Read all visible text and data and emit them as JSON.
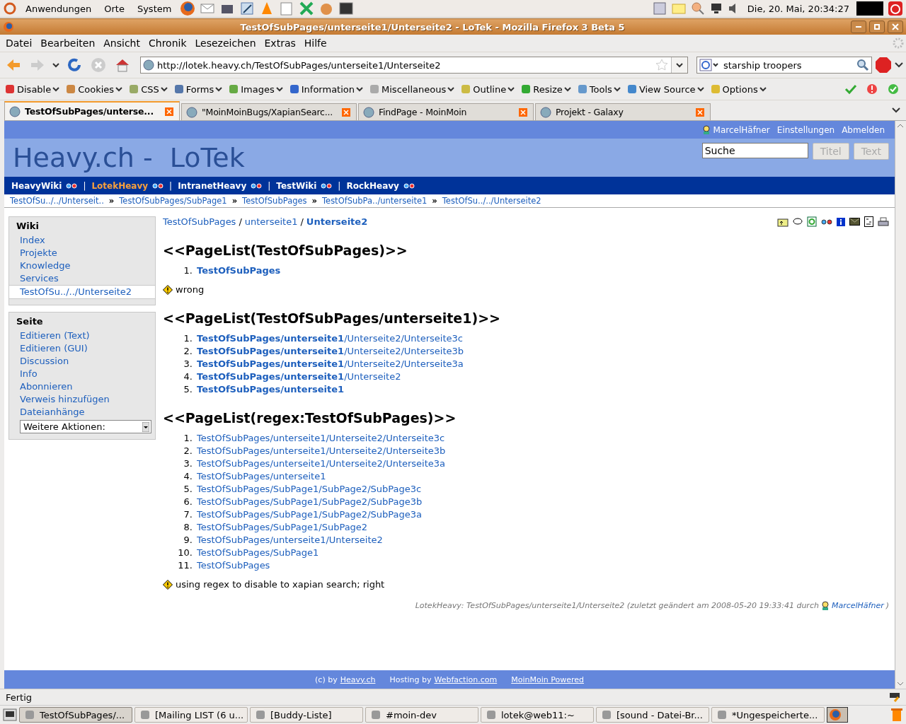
{
  "top_panel": {
    "menus": [
      "Anwendungen",
      "Orte",
      "System"
    ],
    "clock": "Die, 20. Mai, 20:34:27"
  },
  "window": {
    "title": "TestOfSubPages/unterseite1/Unterseite2 - LoTek - Mozilla Firefox 3 Beta 5"
  },
  "menu_bar": [
    "Datei",
    "Bearbeiten",
    "Ansicht",
    "Chronik",
    "Lesezeichen",
    "Extras",
    "Hilfe"
  ],
  "address_bar": {
    "value": "http://lotek.heavy.ch/TestOfSubPages/unterseite1/Unterseite2"
  },
  "search_bar": {
    "value": "starship troopers"
  },
  "dev_toolbar": [
    "Disable",
    "Cookies",
    "CSS",
    "Forms",
    "Images",
    "Information",
    "Miscellaneous",
    "Outline",
    "Resize",
    "Tools",
    "View Source",
    "Options"
  ],
  "tabs": [
    {
      "label": "TestOfSubPages/unterse...",
      "selected": true
    },
    {
      "label": "\"MoinMoinBugs/XapianSearc...",
      "selected": false
    },
    {
      "label": "FindPage - MoinMoin",
      "selected": false
    },
    {
      "label": "Projekt - Galaxy",
      "selected": false
    }
  ],
  "wiki": {
    "user_links": [
      "MarcelHäfner",
      "Einstellungen",
      "Abmelden"
    ],
    "logo": "Heavy.ch -  LoTek",
    "search": {
      "value": "Suche"
    },
    "search_buttons": [
      {
        "label": "Titel",
        "disabled": true
      },
      {
        "label": "Text",
        "disabled": true
      }
    ],
    "interwiki": [
      {
        "label": "HeavyWiki",
        "selected": false
      },
      {
        "sep": "|",
        "label": "LotekHeavy",
        "selected": true
      },
      {
        "sep": "|",
        "label": "IntranetHeavy",
        "selected": false
      },
      {
        "sep": "|",
        "label": "TestWiki",
        "selected": false
      },
      {
        "sep": "|",
        "label": "RockHeavy",
        "selected": false
      }
    ],
    "breadcrumbs": [
      {
        "label": "TestOfSu../../Unterseit.."
      },
      {
        "sep": "»",
        "label": "TestOfSubPages/SubPage1"
      },
      {
        "sep": "»",
        "label": "TestOfSubPages"
      },
      {
        "sep": "»",
        "label": "TestOfSubPa../unterseite1"
      },
      {
        "sep": "»",
        "label": "TestOfSu../../Unterseite2"
      }
    ],
    "sidebar": [
      {
        "title": "Wiki",
        "items": [
          {
            "label": "Index",
            "selected": false
          },
          {
            "label": "Projekte",
            "selected": false
          },
          {
            "label": "Knowledge",
            "selected": false
          },
          {
            "label": "Services",
            "selected": false
          },
          {
            "label": "TestOfSu../../Unterseite2",
            "selected": true
          }
        ]
      },
      {
        "title": "Seite",
        "items": [
          {
            "label": "Editieren (Text)",
            "selected": false
          },
          {
            "label": "Editieren (GUI)",
            "selected": false
          },
          {
            "label": "Discussion",
            "selected": false
          },
          {
            "label": "Info",
            "selected": false
          },
          {
            "label": "Abonnieren",
            "selected": false
          },
          {
            "label": "Verweis hinzufügen",
            "selected": false
          },
          {
            "label": "Dateianhänge",
            "selected": false
          }
        ],
        "dropdown": "Weitere Aktionen:"
      }
    ],
    "page_path": [
      {
        "label": "TestOfSubPages"
      },
      {
        "sep": "/",
        "label": "unterseite1"
      },
      {
        "sep": "/",
        "label": "Unterseite2"
      }
    ],
    "blocks": [
      {
        "kind": "heading",
        "text": "<<PageList(TestOfSubPages)>>"
      },
      {
        "kind": "list",
        "items": [
          {
            "num": "1.",
            "text": "**TestOfSubPages**"
          }
        ]
      },
      {
        "kind": "note",
        "text": "wrong"
      },
      {
        "kind": "heading",
        "text": "<<PageList(TestOfSubPages/unterseite1)>>"
      },
      {
        "kind": "list",
        "items": [
          {
            "num": "1.",
            "text": "**TestOfSubPages/unterseite1**/Unterseite2/Unterseite3c"
          },
          {
            "num": "2.",
            "text": "**TestOfSubPages/unterseite1**/Unterseite2/Unterseite3b"
          },
          {
            "num": "3.",
            "text": "**TestOfSubPages/unterseite1**/Unterseite2/Unterseite3a"
          },
          {
            "num": "4.",
            "text": "**TestOfSubPages/unterseite1**/Unterseite2"
          },
          {
            "num": "5.",
            "text": "**TestOfSubPages/unterseite1**"
          }
        ]
      },
      {
        "kind": "heading",
        "text": "<<PageList(regex:TestOfSubPages)>>"
      },
      {
        "kind": "list",
        "items": [
          {
            "num": "1.",
            "text": "TestOfSubPages/unterseite1/Unterseite2/Unterseite3c"
          },
          {
            "num": "2.",
            "text": "TestOfSubPages/unterseite1/Unterseite2/Unterseite3b"
          },
          {
            "num": "3.",
            "text": "TestOfSubPages/unterseite1/Unterseite2/Unterseite3a"
          },
          {
            "num": "4.",
            "text": "TestOfSubPages/unterseite1"
          },
          {
            "num": "5.",
            "text": "TestOfSubPages/SubPage1/SubPage2/SubPage3c"
          },
          {
            "num": "6.",
            "text": "TestOfSubPages/SubPage1/SubPage2/SubPage3b"
          },
          {
            "num": "7.",
            "text": "TestOfSubPages/SubPage1/SubPage2/SubPage3a"
          },
          {
            "num": "8.",
            "text": "TestOfSubPages/SubPage1/SubPage2"
          },
          {
            "num": "9.",
            "text": "TestOfSubPages/unterseite1/Unterseite2"
          },
          {
            "num": "10.",
            "text": "TestOfSubPages/SubPage1"
          },
          {
            "num": "11.",
            "text": "TestOfSubPages"
          }
        ]
      },
      {
        "kind": "note",
        "text": "using regex to disable to xapian search; right"
      }
    ],
    "page_info": {
      "text": "LotekHeavy: TestOfSubPages/unterseite1/Unterseite2 (zuletzt geändert am 2008-05-20 19:33:41 durch",
      "author": "MarcelHäfner",
      "close": ")"
    },
    "footer": [
      {
        "text": "(c) by",
        "link": "Heavy.ch"
      },
      {
        "text": "Hosting by",
        "link": "Webfaction.com"
      },
      {
        "link": "MoinMoin Powered"
      }
    ]
  },
  "status_bar": "Fertig",
  "taskbar": [
    {
      "label": "TestOfSubPages/...",
      "selected": true
    },
    {
      "label": "[Mailing LIST (6 u...",
      "selected": false
    },
    {
      "label": "[Buddy-Liste]",
      "selected": false
    },
    {
      "label": "#moin-dev",
      "selected": false
    },
    {
      "label": "lotek@web11:~",
      "selected": false
    },
    {
      "label": "[sound - Datei-Br...",
      "selected": false
    },
    {
      "label": "*Ungespeicherte...",
      "selected": false
    }
  ]
}
